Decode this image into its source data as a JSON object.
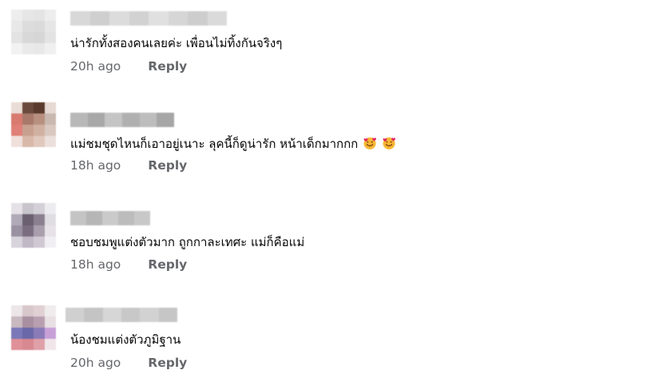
{
  "comments": [
    {
      "text": "น่ารักทั้งสองคนเลยค่ะ เพื่อนไม่ทิ้งกันจริงๆ",
      "time": "20h ago",
      "reply_label": "Reply",
      "emojis": []
    },
    {
      "text": "แม่ชมชุดไหนก็เอาอยู่เนาะ ลุคนี้ก็ดูน่ารัก หน้าเด็กมากกก",
      "time": "18h ago",
      "reply_label": "Reply",
      "emojis": [
        "smiling-face-with-hearts-icon",
        "smiling-face-with-hearts-icon"
      ]
    },
    {
      "text": "ชอบชมพูแต่งตัวมาก ถูกกาละเทศะ แม่ก็คือแม่",
      "time": "18h ago",
      "reply_label": "Reply",
      "emojis": []
    },
    {
      "text": "น้องชมแต่งตัวภูมิฐาน",
      "time": "20h ago",
      "reply_label": "Reply",
      "emojis": []
    }
  ],
  "colors": {
    "meta_text": "#65676b",
    "comment_text": "#050505",
    "emoji_face": "#f7b733",
    "emoji_heart": "#e0245e"
  }
}
